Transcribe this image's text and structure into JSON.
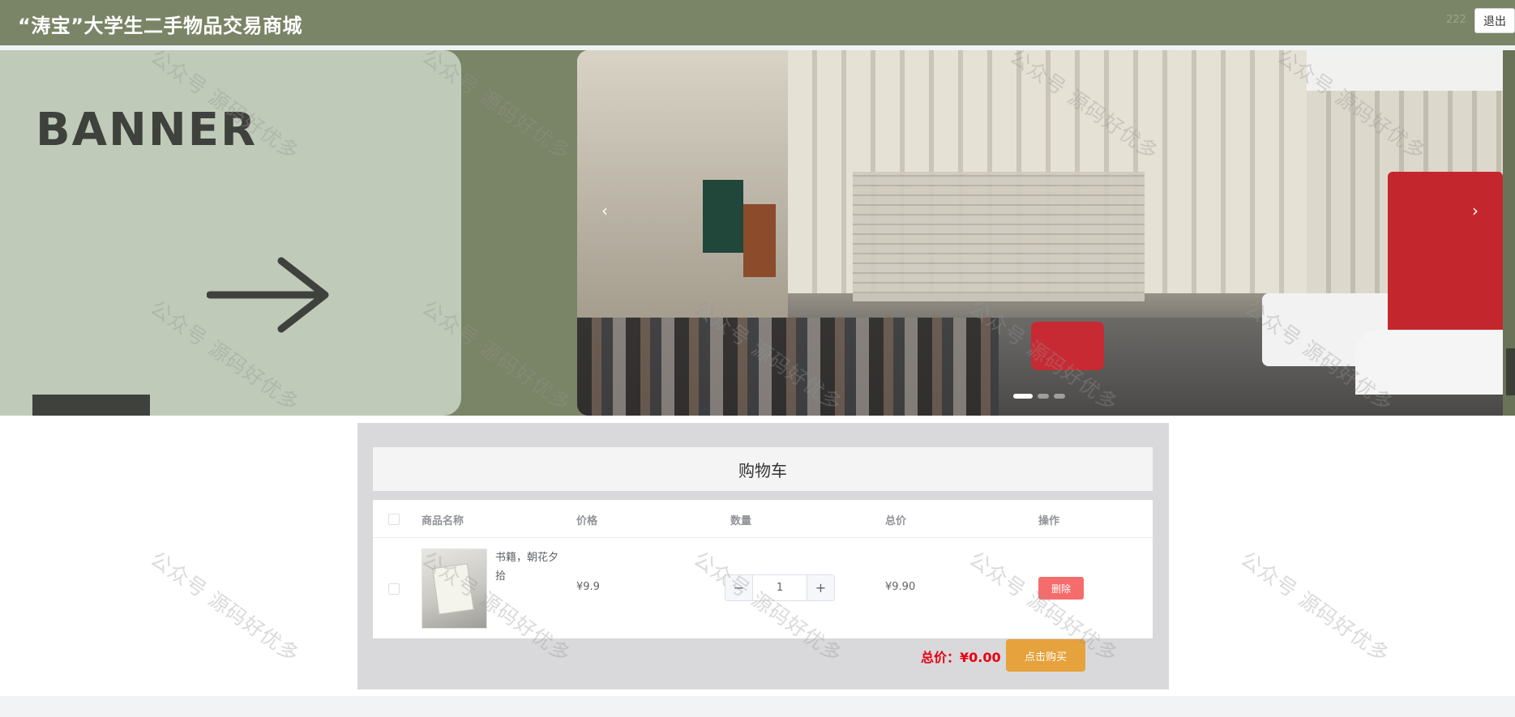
{
  "header": {
    "title": "“涛宝”大学生二手物品交易商城",
    "username": "222",
    "logout_label": "退出"
  },
  "carousel": {
    "banner_text": "BANNER",
    "prev_icon": "‹",
    "next_icon": "›",
    "slide_count": 3,
    "active_slide": 1
  },
  "cart": {
    "title": "购物车",
    "columns": {
      "name": "商品名称",
      "price": "价格",
      "quantity": "数量",
      "subtotal": "总价",
      "action": "操作"
    },
    "items": [
      {
        "name": "书籍，朝花夕拾",
        "price": "¥9.9",
        "quantity": "1",
        "subtotal": "¥9.90",
        "delete_label": "删除"
      }
    ],
    "stepper_minus": "−",
    "stepper_plus": "+",
    "total_label": "总价：¥0.00",
    "buy_label": "点击购买"
  },
  "watermark": "公众号 源码好优多",
  "colors": {
    "header_bg": "#7a8466",
    "banner_bg": "#bfcab8",
    "delete_btn": "#f56c6c",
    "buy_btn": "#e6a23c",
    "total_text": "#e60012"
  }
}
